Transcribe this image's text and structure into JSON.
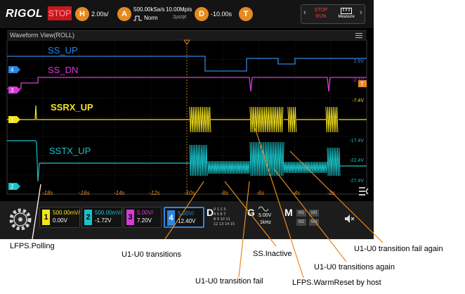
{
  "toolbar": {
    "brand": "RIGOL",
    "run_state": "STOP",
    "horizontal_key": "H",
    "timebase": "2.00s/",
    "acquire_key": "A",
    "sample_rate": "500.00kSa/s",
    "acq_mode": "Norm",
    "memory_depth": "10.00Mpts",
    "time_per_point": "2µs/pt",
    "delay_key": "D",
    "delay": "-10.00s",
    "trigger_key": "T",
    "stop_run_label": "STOP RUN",
    "measure_label": "Measure"
  },
  "waveform_view": {
    "title": "Waveform View(ROLL)"
  },
  "traces": [
    {
      "channel": "4",
      "name": "SS_UP",
      "value_label": "2.6V",
      "color": "#2e86de"
    },
    {
      "channel": "3",
      "name": "SS_DN",
      "value_label": "-2.1V",
      "color": "#d63bd6"
    },
    {
      "channel": "1",
      "name": "SSRX_UP",
      "value_label": "-7.4V",
      "color": "#f4e21c"
    },
    {
      "channel": "2",
      "name": "SSTX_UP",
      "value_label": "-17.4V",
      "color": "#19c3c9"
    }
  ],
  "right_axis_labels": [
    "-22.4V",
    "-27.4V"
  ],
  "trigger_marker": "T",
  "time_ticks": [
    "-18s",
    "-16s",
    "-14s",
    "-12s",
    "-10s",
    "-8s",
    "-6s",
    "-4s",
    "-2s"
  ],
  "channels": [
    {
      "num": "1",
      "scale": "500.00mV/",
      "offset": "0.00V",
      "color": "#f4e21c"
    },
    {
      "num": "2",
      "scale": "500.00mV/",
      "offset": "-1.72V",
      "color": "#19c3c9"
    },
    {
      "num": "3",
      "scale": "5.00V/",
      "offset": "7.20V",
      "color": "#d63bd6"
    },
    {
      "num": "4",
      "scale": "5.00V/",
      "offset": "12.40V",
      "color": "#2e86de"
    }
  ],
  "digital": {
    "key": "D",
    "rows": [
      "0 1 2 3",
      "4 5 6 7",
      "8 9 10 11",
      "12 13 14 15"
    ]
  },
  "generator": {
    "key": "G",
    "amplitude": "5.00V",
    "frequency": "1kHz"
  },
  "math": {
    "key": "M",
    "buttons": [
      "M1",
      "M3",
      "M2",
      "M4"
    ]
  },
  "annotations": {
    "lfps_polling": "LFPS.Polling",
    "u1u0_transitions": "U1-U0 transitions",
    "u1u0_fail": "U1-U0 transition fail",
    "ss_inactive": "SS.Inactive",
    "lfps_warmreset": "LFPS.WarmReset by host",
    "u1u0_again": "U1-U0 transitions again",
    "u1u0_fail_again": "U1-U0 transition fail again"
  }
}
